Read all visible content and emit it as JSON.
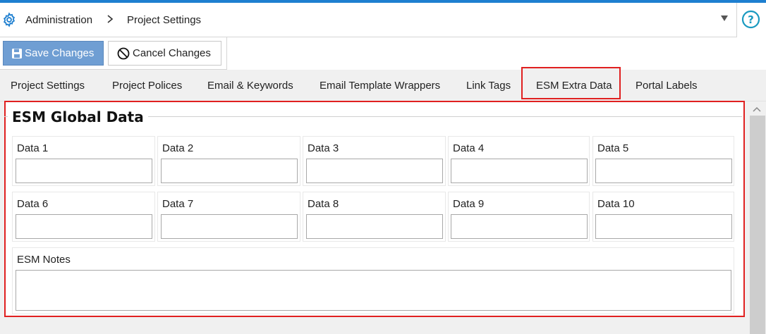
{
  "header": {
    "breadcrumb": [
      "Administration",
      "Project Settings"
    ],
    "icons": {
      "settings": "gear-icon",
      "separator": "chevron-right-icon",
      "dropdown": "caret-down-icon",
      "help": "help-icon"
    }
  },
  "toolbar": {
    "save_label": "Save Changes",
    "cancel_label": "Cancel Changes"
  },
  "tabs": [
    {
      "label": "Project Settings",
      "active": false
    },
    {
      "label": "Project Polices",
      "active": false
    },
    {
      "label": "Email & Keywords",
      "active": false
    },
    {
      "label": "Email Template Wrappers",
      "active": false
    },
    {
      "label": "Link Tags",
      "active": false
    },
    {
      "label": "ESM Extra Data",
      "active": true
    },
    {
      "label": "Portal Labels",
      "active": false
    }
  ],
  "group": {
    "title": "ESM Global Data",
    "fields": [
      {
        "label": "Data 1",
        "value": ""
      },
      {
        "label": "Data 2",
        "value": ""
      },
      {
        "label": "Data 3",
        "value": ""
      },
      {
        "label": "Data 4",
        "value": ""
      },
      {
        "label": "Data 5",
        "value": ""
      },
      {
        "label": "Data 6",
        "value": ""
      },
      {
        "label": "Data 7",
        "value": ""
      },
      {
        "label": "Data 8",
        "value": ""
      },
      {
        "label": "Data 9",
        "value": ""
      },
      {
        "label": "Data 10",
        "value": ""
      }
    ],
    "notes": {
      "label": "ESM Notes",
      "value": ""
    }
  },
  "colors": {
    "accent": "#1e7fd0",
    "save_button": "#6f9ed3",
    "highlight": "#e02020",
    "tab_bar": "#f0f0f0"
  }
}
